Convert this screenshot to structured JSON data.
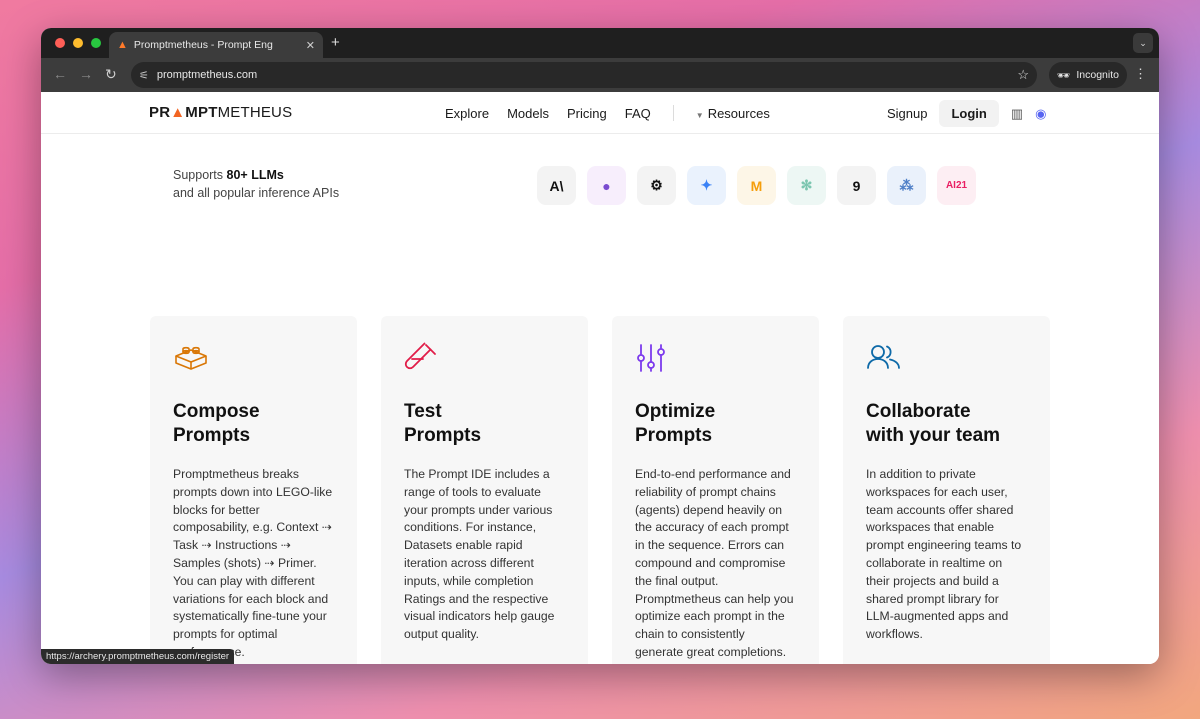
{
  "browser": {
    "tab_title": "Promptmetheus - Prompt Eng",
    "new_tab": "+",
    "url": "promptmetheus.com",
    "incognito_label": "Incognito",
    "status_url": "https://archery.promptmetheus.com/register"
  },
  "site": {
    "logo_parts": [
      "PR",
      "MPT",
      "METHEUS"
    ],
    "nav": [
      "Explore",
      "Models",
      "Pricing",
      "FAQ"
    ],
    "resources_label": "Resources",
    "signup_label": "Signup",
    "login_label": "Login"
  },
  "supports": {
    "prefix": "Supports ",
    "highlight": "80+ LLMs",
    "line2": "and all popular inference APIs"
  },
  "llm_logos": [
    {
      "name": "anthropic",
      "glyph": "A\\",
      "bg": "#f3f3f3",
      "fg": "#111111"
    },
    {
      "name": "cohere",
      "glyph": "●",
      "bg": "#f7eefc",
      "fg": "#7a4bd0"
    },
    {
      "name": "openai",
      "glyph": "⚙",
      "bg": "#f3f3f3",
      "fg": "#111111"
    },
    {
      "name": "gemini",
      "glyph": "✦",
      "bg": "#eaf2fd",
      "fg": "#3b82f6"
    },
    {
      "name": "mistral",
      "glyph": "M",
      "bg": "#fdf6e7",
      "fg": "#f59e0b"
    },
    {
      "name": "perplexity",
      "glyph": "✻",
      "bg": "#edf7f4",
      "fg": "#7cc6b0"
    },
    {
      "name": "deepinfra",
      "glyph": "9",
      "bg": "#f3f3f3",
      "fg": "#111111"
    },
    {
      "name": "groq",
      "glyph": "⁂",
      "bg": "#eaf1fb",
      "fg": "#4f7fc7"
    },
    {
      "name": "ai21",
      "glyph": "AI21",
      "bg": "#fdeef3",
      "fg": "#e91e63"
    }
  ],
  "cards": [
    {
      "title_1": "Compose",
      "title_2": "Prompts",
      "body": "Promptmetheus breaks prompts down into LEGO-like blocks for better composability, e.g. Context ⇢ Task ⇢ Instructions ⇢ Samples (shots) ⇢ Primer. You can play with different variations for each block and systematically fine-tune your prompts for optimal performance.",
      "icon_color": "#d97706"
    },
    {
      "title_1": "Test",
      "title_2": "Prompts",
      "body": "The Prompt IDE includes a range of tools to evaluate your prompts under various conditions. For instance, Datasets enable rapid iteration across different inputs, while completion Ratings and the respective visual indicators help gauge output quality.",
      "icon_color": "#e11d48"
    },
    {
      "title_1": "Optimize",
      "title_2": "Prompts",
      "body": "End-to-end performance and reliability of prompt chains (agents) depend heavily on the accuracy of each prompt in the sequence. Errors can compound and compromise the final output. Promptmetheus can help you optimize each prompt in the chain to consistently generate great completions.",
      "icon_color": "#7c3aed"
    },
    {
      "title_1": "Collaborate",
      "title_2": "with your team",
      "body": "In addition to private workspaces for each user, team accounts offer shared workspaces that enable prompt engineering teams to collaborate in realtime on their projects and build a shared prompt library for LLM-augmented apps and workflows.",
      "icon_color": "#0e6aa8"
    }
  ]
}
